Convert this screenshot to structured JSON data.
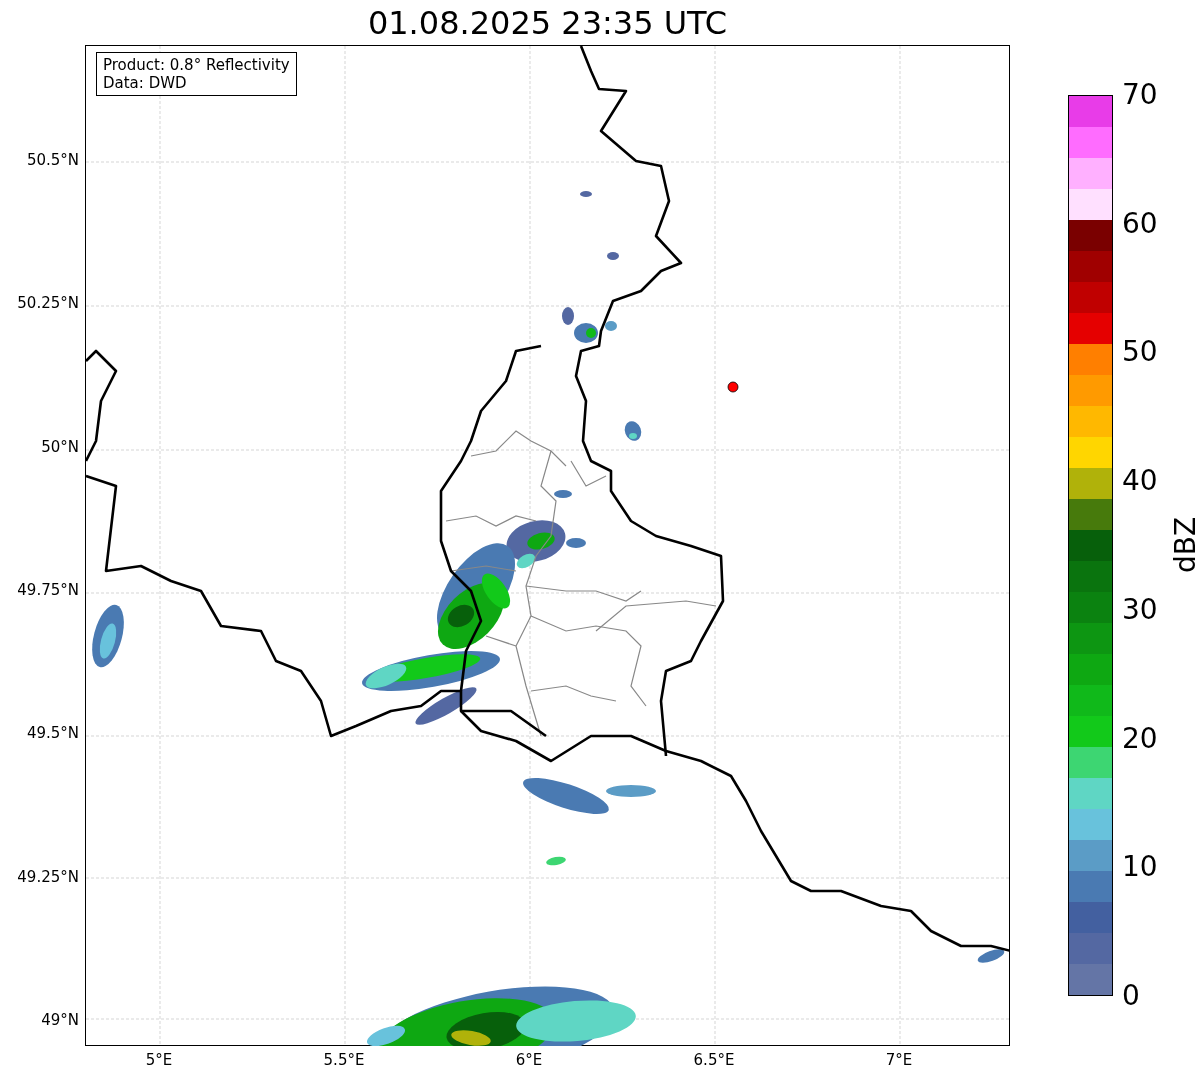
{
  "title": "01.08.2025 23:35 UTC",
  "info_box": [
    "Product: 0.8° Reflectivity",
    "Data: DWD"
  ],
  "map": {
    "lat_labels": [
      "50.5°N",
      "50.25°N",
      "50°N",
      "49.75°N",
      "49.5°N",
      "49.25°N",
      "49°N"
    ],
    "lon_labels": [
      "5°E",
      "5.5°E",
      "6°E",
      "6.5°E",
      "7°E"
    ]
  },
  "colorbar": {
    "ticks": [
      "70",
      "60",
      "50",
      "40",
      "30",
      "20",
      "10",
      "0"
    ],
    "label": "dBZ",
    "bins": [
      {
        "color": "#e83ce8"
      },
      {
        "color": "#ff6cff"
      },
      {
        "color": "#ffb0ff"
      },
      {
        "color": "#ffe0ff"
      },
      {
        "color": "#7a0000"
      },
      {
        "color": "#a00000"
      },
      {
        "color": "#c00000"
      },
      {
        "color": "#e50000"
      },
      {
        "color": "#ff7f00"
      },
      {
        "color": "#ff9a00"
      },
      {
        "color": "#ffb800"
      },
      {
        "color": "#ffd600"
      },
      {
        "color": "#b0b20a"
      },
      {
        "color": "#477a0c"
      },
      {
        "color": "#07600b"
      },
      {
        "color": "#0a740e"
      },
      {
        "color": "#0b8210"
      },
      {
        "color": "#0d9612"
      },
      {
        "color": "#0ea812"
      },
      {
        "color": "#10b91a"
      },
      {
        "color": "#12c91a"
      },
      {
        "color": "#3dd672"
      },
      {
        "color": "#5fd6c4"
      },
      {
        "color": "#68c2dc"
      },
      {
        "color": "#5b9cc6"
      },
      {
        "color": "#4a7ab2"
      },
      {
        "color": "#4360a0"
      },
      {
        "color": "#5468a2"
      },
      {
        "color": "#6475a6"
      }
    ]
  }
}
